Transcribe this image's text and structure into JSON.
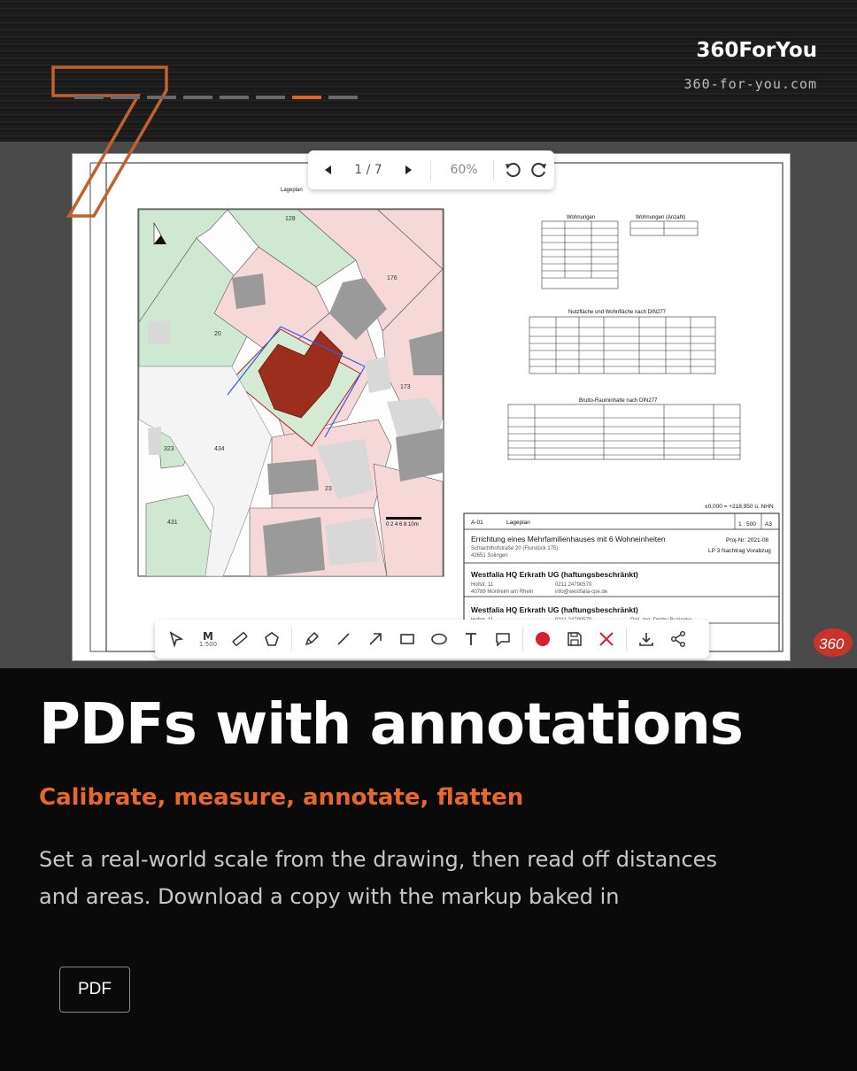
{
  "brand": {
    "name": "360ForYou",
    "url": "360-for-you.com"
  },
  "slide": {
    "number": "7",
    "total_steps": 8,
    "active_step": 7
  },
  "viewer": {
    "page": "1 / 7",
    "zoom": "60%"
  },
  "document": {
    "map_title": "Lageplan",
    "scale_bar": "0  2  4  6  8 10m",
    "elevation": "±0,000 = +218,950 ü. NHN",
    "plot_numbers": [
      "128",
      "176",
      "20",
      "173",
      "434",
      "23",
      "323",
      "431"
    ],
    "table1_title": "Wohnungen",
    "table2_title": "Wohnungen (Anzahl)",
    "table3_title": "Nutzfläche und Wohnfläche nach DIN277",
    "table4_title": "Brutto-Rauminhalte nach DIN277",
    "titleblock": {
      "sheet": "A-01",
      "sheet_name": "Lageplan",
      "scale": "1 : 500",
      "format": "A3",
      "project": "Errichtung eines Mehrfamilienhauses mit 6 Wohneinheiten",
      "project_no": "Proj-Nr: 2021-08",
      "address1": "Schlachthofstraße 20 (Flurstück 175)",
      "address2": "42651 Solingen",
      "phase": "LP 3 Nachtrag Vorabzug",
      "client": "Westfalia HQ Erkrath UG (haftungsbeschränkt)",
      "client_street": "Hofstr. 11",
      "client_city": "40789 Monheim am Rhein",
      "client_phone": "0211 24790570",
      "client_mail": "info@westfalia-cpe.de",
      "owner": "Westfalia HQ Erkrath UG (haftungsbeschränkt)",
      "owner_street": "Hofstr. 11",
      "owner_phone": "0211 24790570",
      "architect": "Dipl.-Ing. Dmitry Buzienko"
    }
  },
  "toolbar": {
    "calibrate_label": "M",
    "calibrate_scale": "1:500",
    "items": [
      "select",
      "calibrate",
      "measure-distance",
      "measure-area",
      "pen",
      "line",
      "arrow",
      "rectangle",
      "ellipse",
      "text",
      "comment",
      "color",
      "save",
      "delete",
      "download",
      "share"
    ]
  },
  "content": {
    "title": "PDFs with annotations",
    "subtitle": "Calibrate, measure, annotate, flatten",
    "description": "Set a real-world scale from the drawing, then read off distances and areas. Download a copy with the markup baked in",
    "tag": "PDF"
  },
  "colors": {
    "accent": "#e8672c",
    "active_record": "#d72030",
    "delete": "#d72030"
  }
}
